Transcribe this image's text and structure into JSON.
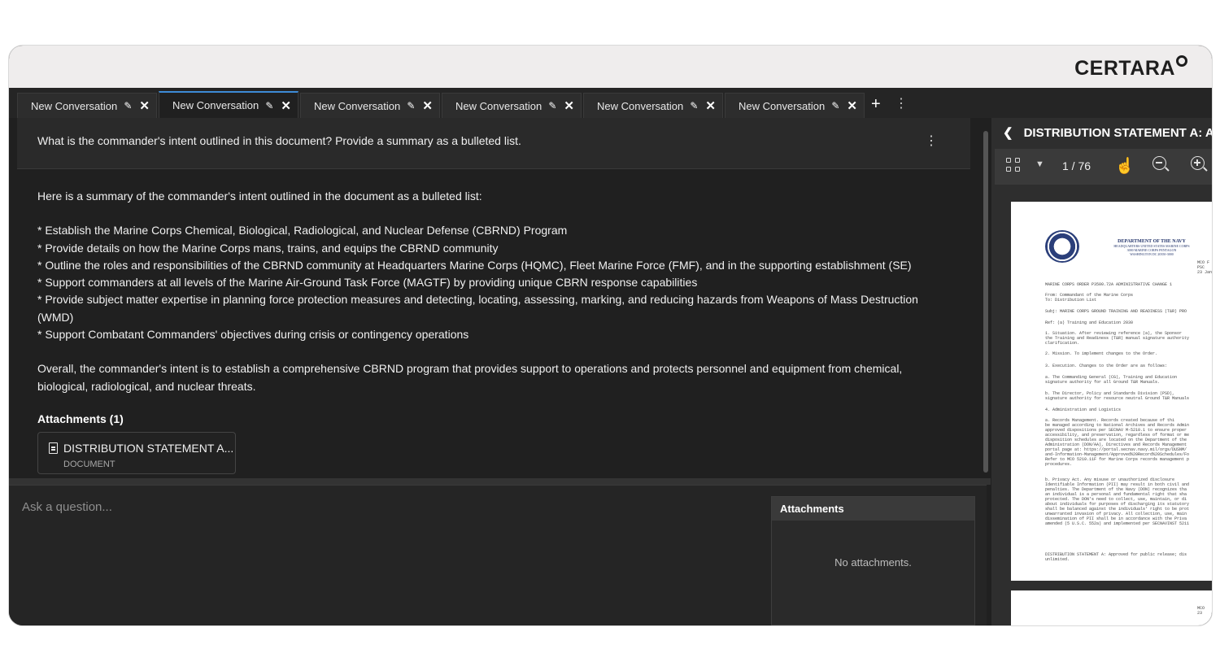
{
  "brand": {
    "logo_text": "CERTARA"
  },
  "tabs": [
    {
      "label": "New Conversation",
      "active": false
    },
    {
      "label": "New Conversation",
      "active": true
    },
    {
      "label": "New Conversation",
      "active": false
    },
    {
      "label": "New Conversation",
      "active": false
    },
    {
      "label": "New Conversation",
      "active": false
    },
    {
      "label": "New Conversation",
      "active": false
    }
  ],
  "tab_icons": {
    "edit": "pencil-icon",
    "close": "close-icon",
    "add": "plus-icon",
    "more": "vertical-ellipsis-icon"
  },
  "conversation": {
    "question": "What is the commander's intent outlined in this document? Provide a summary as a bulleted list.",
    "answer_intro": "Here is a summary of the commander's intent outlined in the document as a bulleted list:",
    "bullets": [
      "* Establish the Marine Corps Chemical, Biological, Radiological, and Nuclear Defense (CBRND) Program",
      "* Provide details on how the Marine Corps mans, trains, and equips the CBRND community",
      "* Outline the roles and responsibilities of the CBRND community at Headquarters Marine Corps (HQMC), Fleet Marine Force (FMF), and in the supporting establishment (SE)",
      "* Support commanders at all levels of the Marine Air-Ground Task Force (MAGTF) by providing unique CBRN response capabilities",
      "* Provide subject matter expertise in planning force protection measures and detecting, locating, assessing, marking, and reducing hazards from Weapons of Mass Destruction (WMD)",
      "* Support Combatant Commanders' objectives during crisis or contingency operations"
    ],
    "answer_summary": "Overall, the commander's intent is to establish a comprehensive CBRND program that provides support to operations and protects personnel and equipment from chemical, biological, radiological, and nuclear threats.",
    "attachments_title": "Attachments (1)",
    "attachment": {
      "name": "DISTRIBUTION STATEMENT A...",
      "type": "DOCUMENT"
    }
  },
  "composer": {
    "placeholder": "Ask a question...",
    "attachments_header": "Attachments",
    "attachments_empty": "No attachments."
  },
  "viewer": {
    "title": "DISTRIBUTION STATEMENT A: Ap",
    "page_indicator": "1 / 76",
    "pdf": {
      "header_line1": "DEPARTMENT OF THE NAVY",
      "header_line2": "HEADQUARTERS UNITED STATES MARINE CORPS",
      "header_line3": "3000 MARINE CORPS PENTAGON",
      "header_line4": "WASHINGTON DC 20350-3000",
      "ref_right": [
        "MCO F",
        "PSC",
        "23 Jan"
      ],
      "lines": [
        "MARINE CORPS ORDER P3500.72A ADMINISTRATIVE CHANGE 1",
        "From: Commandant of the Marine Corps",
        "To:   Distribution List",
        "Subj: MARINE CORPS GROUND TRAINING AND READINESS (T&R) PRO",
        "Ref:  (a) Training and Education 2030",
        "1. Situation. After reviewing reference (a), the Sponsor",
        "the Training and Readiness (T&R) manual signature authority",
        "clarification.",
        "2. Mission. To implement changes to the Order.",
        "3. Execution. Changes to the Order are as follows:",
        "   a. The Commanding General (CG), Training and Education",
        "signature authority for all Ground T&R Manuals.",
        "   b. The Director, Policy and Standards Division (PSD),",
        "signature authority for resource neutral Ground T&R Manuals",
        "4. Administration and Logistics",
        "   a. Records Management. Records created because of thi",
        "be managed according to National Archives and Records Admin",
        "approved dispositions per SECNAV M-5210.1 to ensure proper",
        "accessibility, and preservation, regardless of format or me",
        "disposition schedules are located on the Department of the",
        "Administration (DON/AA), Directives and Records Management",
        "portal page at: https://portal.secnav.navy.mil/orgs/DUSNM/",
        "and-Information-Management/Approved%20Record%20Schedules/Fo",
        "Refer to MCO 5210.11F for Marine Corps records management p",
        "procedures.",
        "   b. Privacy Act. Any misuse or unauthorized disclosure",
        "Identifiable Information (PII) may result in both civil and",
        "penalties. The Department of the Navy (DON) recognizes tha",
        "an individual is a personal and fundamental right that sha",
        "protected. The DON's need to collect, use, maintain, or di",
        "about individuals for purposes of discharging its statutory",
        "shall be balanced against the individuals' right to be prot",
        "unwarranted invasion of privacy. All collection, use, main",
        "dissemination of PII shall be in accordance with the Priva",
        "amended (5 U.S.C. 552a) and implemented per SECNAVINST 5211",
        "DISTRIBUTION STATEMENT A: Approved for public release; dis",
        "unlimited."
      ],
      "page2_ref": [
        "MCO",
        "23"
      ]
    }
  },
  "colors": {
    "accent": "#3d8bd6",
    "background": "#202020",
    "panel": "#2a2a2a"
  }
}
